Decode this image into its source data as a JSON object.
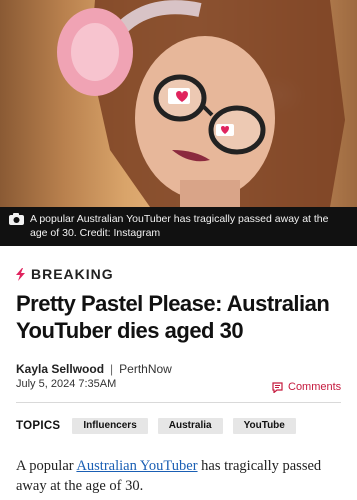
{
  "hero": {
    "caption": "A popular Australian YouTuber has tragically passed away at the age of 30. Credit: Instagram",
    "camera_icon": "camera-icon"
  },
  "article": {
    "label": "BREAKING",
    "label_icon": "lightning-bolt-icon",
    "headline": "Pretty Pastel Please: Australian YouTuber dies aged 30",
    "author": "Kayla Sellwood",
    "outlet": "PerthNow",
    "date": "July 5, 2024 7:35AM",
    "comments_label": "Comments",
    "comments_icon": "comment-icon"
  },
  "topics": {
    "label": "TOPICS",
    "items": [
      "Influencers",
      "Australia",
      "YouTube"
    ]
  },
  "body": {
    "lead_prefix": "A popular ",
    "lead_link": "Australian YouTuber",
    "lead_suffix": " has tragically passed away at the age of 30."
  },
  "colors": {
    "accent": "#e0245e",
    "comments": "#c51a3e",
    "link": "#1a5fb4"
  }
}
